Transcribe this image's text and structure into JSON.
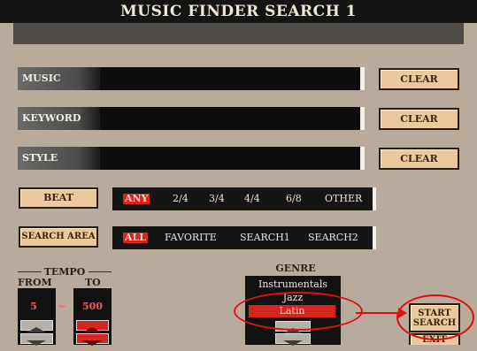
{
  "title": "MUSIC FINDER SEARCH 1",
  "fields": [
    {
      "label": "MUSIC",
      "value": "",
      "clear_label": "CLEAR"
    },
    {
      "label": "KEYWORD",
      "value": "",
      "clear_label": "CLEAR"
    },
    {
      "label": "STYLE",
      "value": "",
      "clear_label": "CLEAR"
    }
  ],
  "beat": {
    "button_label": "BEAT",
    "options": [
      "ANY",
      "2/4",
      "3/4",
      "4/4",
      "6/8",
      "OTHER"
    ],
    "selected": "ANY"
  },
  "search_area": {
    "button_label": "SEARCH AREA",
    "options": [
      "ALL",
      "FAVORITE",
      "SEARCH1",
      "SEARCH2"
    ],
    "selected": "ALL"
  },
  "tempo": {
    "title": "TEMPO",
    "from_label": "FROM",
    "to_label": "TO",
    "from_value": "5",
    "separator": "~",
    "to_value": "500"
  },
  "genre": {
    "title": "GENRE",
    "items": [
      "Instrumentals",
      "Jazz",
      "Latin"
    ],
    "selected": "Latin"
  },
  "start_search_label": "START SEARCH",
  "exit_label": "EXIT",
  "colors": {
    "background": "#b9ab9b",
    "button": "#ecc99d",
    "selected": "#d7241f",
    "annotation": "#e01010"
  }
}
